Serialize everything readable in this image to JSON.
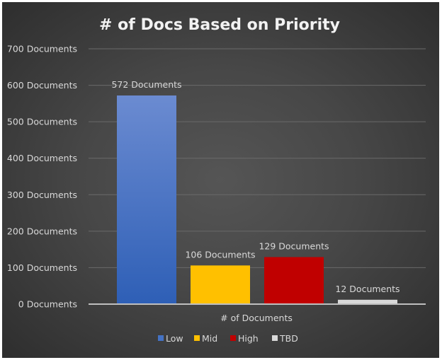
{
  "chart_data": {
    "type": "bar",
    "title": "# of Docs Based on Priority",
    "xlabel": "# of Documents",
    "ylabel": "",
    "ylim": [
      0,
      700
    ],
    "y_ticks": [
      0,
      100,
      200,
      300,
      400,
      500,
      600,
      700
    ],
    "y_tick_suffix": " Documents",
    "grid": true,
    "legend_position": "bottom",
    "categories": [
      "# of Documents"
    ],
    "series": [
      {
        "name": "Low",
        "values": [
          572
        ],
        "color": "#4472c4",
        "label": "572 Documents"
      },
      {
        "name": "Mid",
        "values": [
          106
        ],
        "color": "#ffc000",
        "label": "106 Documents"
      },
      {
        "name": "High",
        "values": [
          129
        ],
        "color": "#c00000",
        "label": "129 Documents"
      },
      {
        "name": "TBD",
        "values": [
          12
        ],
        "color": "#d9d9d9",
        "label": "12 Documents"
      }
    ]
  }
}
